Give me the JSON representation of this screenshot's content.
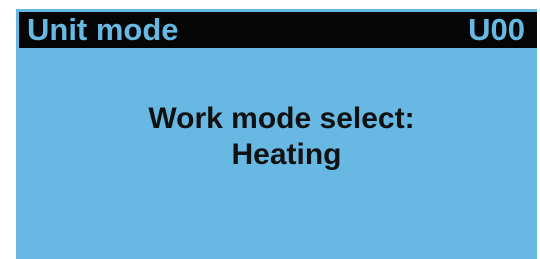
{
  "screen": {
    "background_color": "#67b8e3",
    "header": {
      "title": "Unit mode",
      "code": "U00",
      "background_color": "#050505",
      "text_color": "#67b8e3"
    },
    "content": {
      "label": "Work mode select:",
      "value": "Heating",
      "text_color": "#111111"
    }
  }
}
